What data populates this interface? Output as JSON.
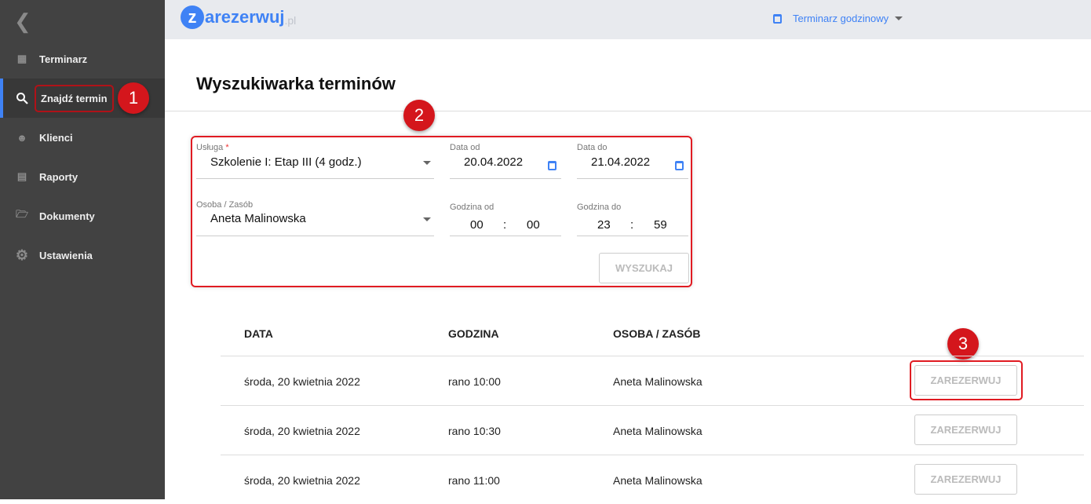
{
  "sidebar": {
    "items": [
      {
        "label": "Terminarz",
        "icon": "calendar-icon"
      },
      {
        "label": "Znajdź termin",
        "icon": "search-icon",
        "active": true
      },
      {
        "label": "Klienci",
        "icon": "people-icon"
      },
      {
        "label": "Raporty",
        "icon": "report-icon"
      },
      {
        "label": "Dokumenty",
        "icon": "folder-icon"
      },
      {
        "label": "Ustawienia",
        "icon": "gear-icon"
      }
    ]
  },
  "header": {
    "logo_z": "z",
    "logo_text": "arezerwuj",
    "logo_tld": ".pl",
    "view_selector": "Terminarz godzinowy"
  },
  "page": {
    "title": "Wyszukiwarka terminów"
  },
  "form": {
    "service_label": "Usługa",
    "required_mark": "*",
    "service_value": "Szkolenie I: Etap III (4 godz.)",
    "date_from_label": "Data od",
    "date_from": "20.04.2022",
    "date_to_label": "Data do",
    "date_to": "21.04.2022",
    "person_label": "Osoba / Zasób",
    "person_value": "Aneta Malinowska",
    "time_from_label": "Godzina od",
    "time_from_h": "00",
    "time_from_m": "00",
    "time_to_label": "Godzina do",
    "time_to_h": "23",
    "time_to_m": "59",
    "sep": ":",
    "search_button": "WYSZUKAJ"
  },
  "table": {
    "headers": [
      "DATA",
      "GODZINA",
      "OSOBA / ZASÓB"
    ],
    "rows": [
      {
        "date": "środa, 20 kwietnia 2022",
        "time": "rano 10:00",
        "person": "Aneta Malinowska",
        "action": "ZAREZERWUJ"
      },
      {
        "date": "środa, 20 kwietnia 2022",
        "time": "rano 10:30",
        "person": "Aneta Malinowska",
        "action": "ZAREZERWUJ"
      },
      {
        "date": "środa, 20 kwietnia 2022",
        "time": "rano 11:00",
        "person": "Aneta Malinowska",
        "action": "ZAREZERWUJ"
      }
    ]
  },
  "annotations": [
    "1",
    "2",
    "3"
  ],
  "colors": {
    "accent": "#3f82f5",
    "sidebar": "#424242",
    "annotation": "#d4161c"
  }
}
